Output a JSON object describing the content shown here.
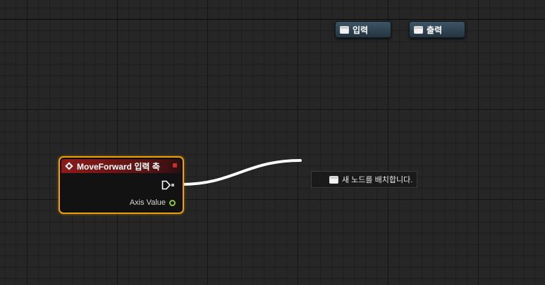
{
  "toolbar": {
    "input_label": "입력",
    "output_label": "출력"
  },
  "node": {
    "title": "MoveForward 입력 축",
    "pin_axis_value": "Axis Value"
  },
  "context_menu": {
    "place_node_label": "새 노드를 배치합니다."
  },
  "colors": {
    "node_selection": "#f0a00a",
    "node_header": "#8c1a1a",
    "float_pin": "#8fca2e",
    "wire": "#ffffff"
  }
}
